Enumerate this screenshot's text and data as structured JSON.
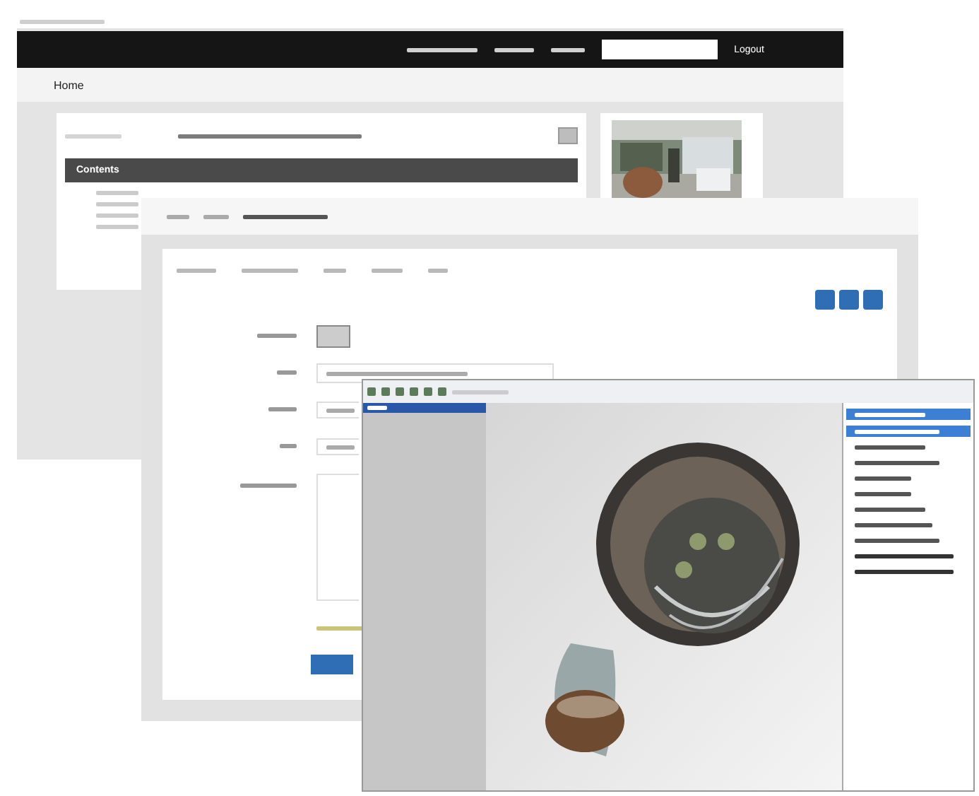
{
  "site": {
    "nav_action": "Logout",
    "breadcrumb": "Home",
    "panel_title": "Contents"
  }
}
